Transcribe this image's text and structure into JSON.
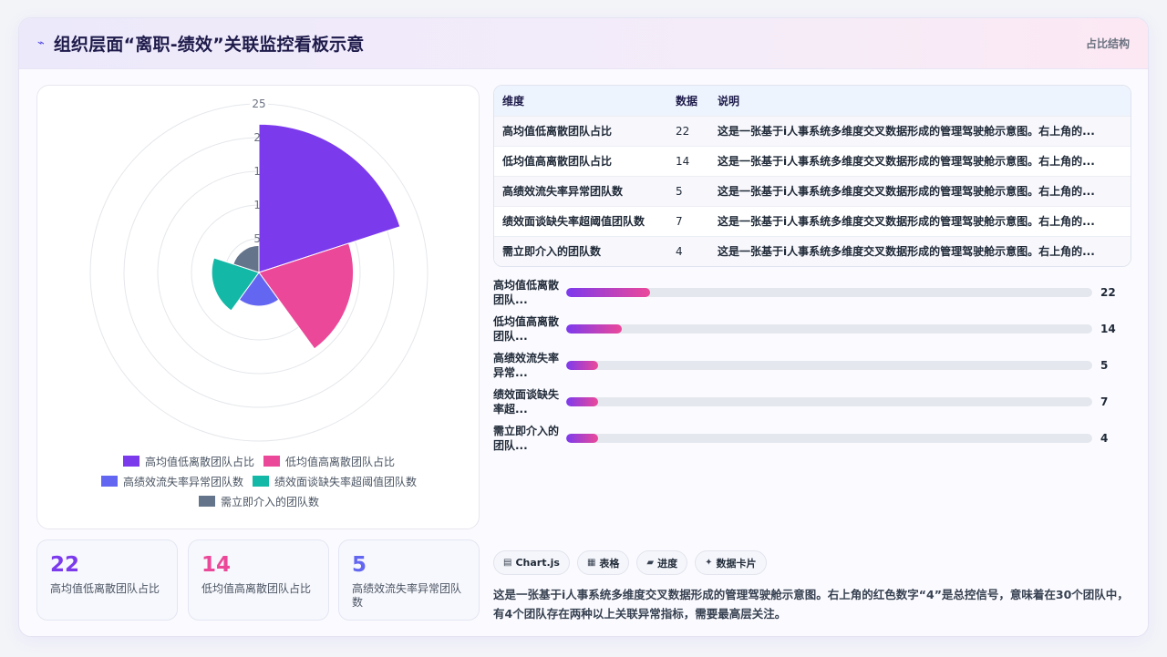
{
  "header": {
    "title": "组织层面“离职-绩效”关联监控看板示意",
    "tag": "占比结构"
  },
  "colors": {
    "violet": "#7c3aed",
    "pink": "#ec4899",
    "indigo": "#6366f1",
    "teal": "#14b8a6",
    "slate": "#64748b"
  },
  "chart_data": {
    "type": "polarArea",
    "rmax": 25,
    "ticks": [
      "5",
      "10",
      "15",
      "20",
      "25"
    ],
    "tick_labels_visible": [
      "25",
      "2",
      "1",
      "1",
      "5"
    ],
    "categories": [
      "高均值低离散团队占比",
      "低均值高离散团队占比",
      "高绩效流失率异常团队数",
      "绩效面谈缺失率超阈值团队数",
      "需立即介入的团队数"
    ],
    "values": [
      22,
      14,
      5,
      7,
      4
    ],
    "colors": [
      "#7c3aed",
      "#ec4899",
      "#6366f1",
      "#14b8a6",
      "#64748b"
    ],
    "legend_position": "bottom"
  },
  "legend": [
    {
      "label": "高均值低离散团队占比",
      "color": "#7c3aed"
    },
    {
      "label": "低均值高离散团队占比",
      "color": "#ec4899"
    },
    {
      "label": "高绩效流失率异常团队数",
      "color": "#6366f1"
    },
    {
      "label": "绩效面谈缺失率超阈值团队数",
      "color": "#14b8a6"
    },
    {
      "label": "需立即介入的团队数",
      "color": "#64748b"
    }
  ],
  "stats": [
    {
      "value": "22",
      "label": "高均值低离散团队占比",
      "color": "#7c3aed"
    },
    {
      "value": "14",
      "label": "低均值高离散团队占比",
      "color": "#ec4899"
    },
    {
      "value": "5",
      "label": "高绩效流失率异常团队数",
      "color": "#6366f1"
    }
  ],
  "table": {
    "headers": [
      "维度",
      "数据",
      "说明"
    ],
    "rows": [
      {
        "name": "高均值低离散团队占比",
        "value": "22",
        "desc": "这是一张基于i人事系统多维度交叉数据形成的管理驾驶舱示意图。右上角的..."
      },
      {
        "name": "低均值高离散团队占比",
        "value": "14",
        "desc": "这是一张基于i人事系统多维度交叉数据形成的管理驾驶舱示意图。右上角的..."
      },
      {
        "name": "高绩效流失率异常团队数",
        "value": "5",
        "desc": "这是一张基于i人事系统多维度交叉数据形成的管理驾驶舱示意图。右上角的..."
      },
      {
        "name": "绩效面谈缺失率超阈值团队数",
        "value": "7",
        "desc": "这是一张基于i人事系统多维度交叉数据形成的管理驾驶舱示意图。右上角的..."
      },
      {
        "name": "需立即介入的团队数",
        "value": "4",
        "desc": "这是一张基于i人事系统多维度交叉数据形成的管理驾驶舱示意图。右上角的..."
      }
    ]
  },
  "bars": [
    {
      "label_line1": "高均值低离散",
      "label_line2": "团队...",
      "value": "22",
      "fill_fraction": 0.16
    },
    {
      "label_line1": "低均值高离散",
      "label_line2": "团队...",
      "value": "14",
      "fill_fraction": 0.105
    },
    {
      "label_line1": "高绩效流失率",
      "label_line2": "异常...",
      "value": "5",
      "fill_fraction": 0.06
    },
    {
      "label_line1": "绩效面谈缺失",
      "label_line2": "率超...",
      "value": "7",
      "fill_fraction": 0.06
    },
    {
      "label_line1": "需立即介入的",
      "label_line2": "团队...",
      "value": "4",
      "fill_fraction": 0.06
    }
  ],
  "chips": [
    {
      "icon": "▤",
      "label": "Chart.js"
    },
    {
      "icon": "▦",
      "label": "表格"
    },
    {
      "icon": "▰",
      "label": "进度"
    },
    {
      "icon": "✦",
      "label": "数据卡片"
    }
  ],
  "note": "这是一张基于i人事系统多维度交叉数据形成的管理驾驶舱示意图。右上角的红色数字“4”是总控信号，意味着在30个团队中，有4个团队存在两种以上关联异常指标，需要最高层关注。"
}
